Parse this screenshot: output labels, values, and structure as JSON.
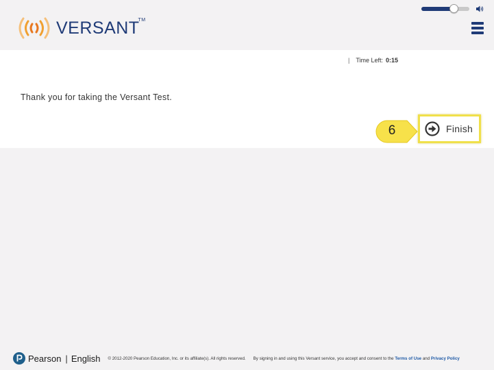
{
  "header": {
    "logo_text": "VERSANT",
    "logo_tm": "TM",
    "brand_color": "#1f3b77",
    "accent_color": "#f0a030",
    "volume_level": 0.72,
    "volume_icon": "speaker-icon",
    "menu_icon": "hamburger-menu-icon"
  },
  "main": {
    "timer_separator": "|",
    "timer_label": "Time Left:",
    "timer_value": "0:15",
    "message": "Thank you for taking the Versant Test.",
    "step_number": "6",
    "step_color": "#f7e14a",
    "finish_label": "Finish",
    "finish_icon": "arrow-right-circle-icon",
    "highlight_color": "#f0e04a"
  },
  "footer": {
    "pearson": "Pearson",
    "separator": "|",
    "english": "English",
    "copyright": "© 2012-2020 Pearson Education, Inc. or its affiliate(s). All rights reserved.",
    "consent_prefix": "By signing in and using this Versant service, you accept and consent to the",
    "terms_label": "Terms of Use",
    "and_text": "and",
    "privacy_label": "Privacy Policy"
  }
}
